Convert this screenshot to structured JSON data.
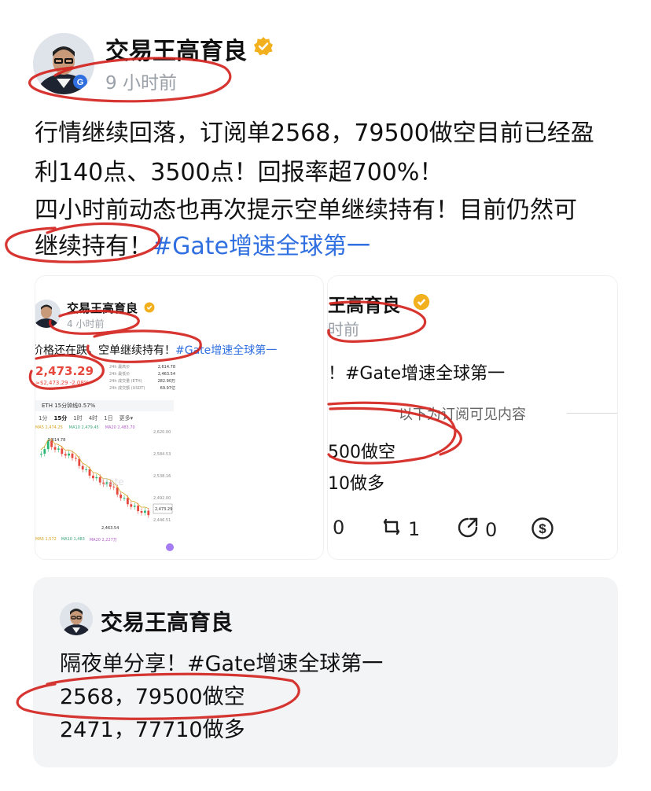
{
  "author": {
    "name": "交易王高育良",
    "time": "9 小时前"
  },
  "post": {
    "line1": "行情继续回落，订阅单2568，79500做空目前已经盈",
    "line2": "利140点、3500点！回报率超700%！",
    "line3": "四小时前动态也再次提示空单继续持有！目前仍然可",
    "line4_text": "继续持有！",
    "line4_tag": "#Gate增速全球第一"
  },
  "image_left": {
    "name": "交易王高育良",
    "time": "4 小时前",
    "text": "价格还在跌，空单继续持有！",
    "tag": "#Gate增速全球第一",
    "price": "2,473.29",
    "price_sub": "≈$2,473.29  -2.08%",
    "pair": "ETH 15分钟线0.57%",
    "intervals": [
      "1分",
      "15分",
      "1时",
      "4时",
      "1日",
      "更多▾"
    ],
    "ma_labels": [
      "MA5 2,474.25",
      "MA10 2,479.45",
      "MA20 2,483.70"
    ],
    "high_label": "2,614.78",
    "low_label": "2,463.54",
    "last_label": "2,473.29",
    "watermark": "Gate",
    "vol_labels": [
      "MA5 1,572",
      "MA10 1,483",
      "MA20 2,227万"
    ],
    "right_axis": [
      "2,620.00",
      "2,584.53",
      "2,538.16",
      "2,492.00",
      "2,446.51"
    ],
    "info_rows": [
      {
        "label": "24h 最高价",
        "value": "2,614.78"
      },
      {
        "label": "24h 最低价",
        "value": "2,463.54"
      },
      {
        "label": "24h 成交量 (ETH)",
        "value": "282.90万"
      },
      {
        "label": "24h 成交额 (USDT)",
        "value": "69.97亿"
      }
    ]
  },
  "image_right": {
    "name": "王高育良",
    "time": "时前",
    "text": "！#Gate增速全球第一",
    "divider_text": "以下为订阅可见内容",
    "row1": "500做空",
    "row2": "10做多",
    "stats": {
      "comments": "0",
      "reposts": "1",
      "likes": "0"
    }
  },
  "quote": {
    "name": "交易王高育良",
    "line1": "隔夜单分享！#Gate增速全球第一",
    "line2": "2568，79500做空",
    "line3": "2471，77710做多"
  },
  "colors": {
    "hashtag": "#2f6fe0",
    "annotation_ink": "#d3241f",
    "verified": "#f2b01e",
    "up_candle": "#2bb673",
    "down_candle": "#e6483d"
  },
  "icons": {
    "verified": "verified-badge-icon",
    "comment": "comment-icon",
    "repost": "repost-icon",
    "like": "like-icon",
    "tip": "dollar-tip-icon"
  }
}
